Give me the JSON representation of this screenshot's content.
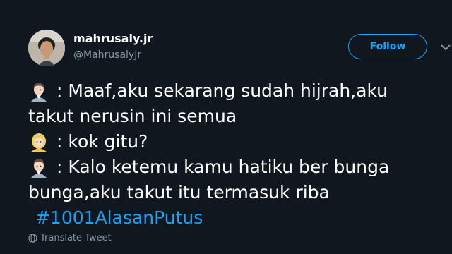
{
  "user": {
    "display_name": "mahrusaly.jr",
    "handle": "@MahrusalyJr"
  },
  "follow_button": {
    "label": "Follow"
  },
  "tweet": {
    "lines": [
      {
        "icon": "man-emoji",
        "text": ": Maaf,aku sekarang sudah hijrah,aku"
      },
      {
        "icon": null,
        "text": "takut nerusin ini semua"
      },
      {
        "icon": "woman-emoji",
        "text": ": kok gitu?"
      },
      {
        "icon": "man-emoji",
        "text": ": Kalo ketemu kamu hatiku ber bunga"
      },
      {
        "icon": null,
        "text": "bunga,aku takut itu termasuk riba"
      }
    ],
    "hashtag": "#1001AlasanPutus"
  },
  "translate": {
    "label": "Translate Tweet",
    "icon": "globe-icon"
  },
  "colors": {
    "background": "#10171e",
    "accent": "#1da1f2",
    "secondary_text": "#8899a6"
  }
}
